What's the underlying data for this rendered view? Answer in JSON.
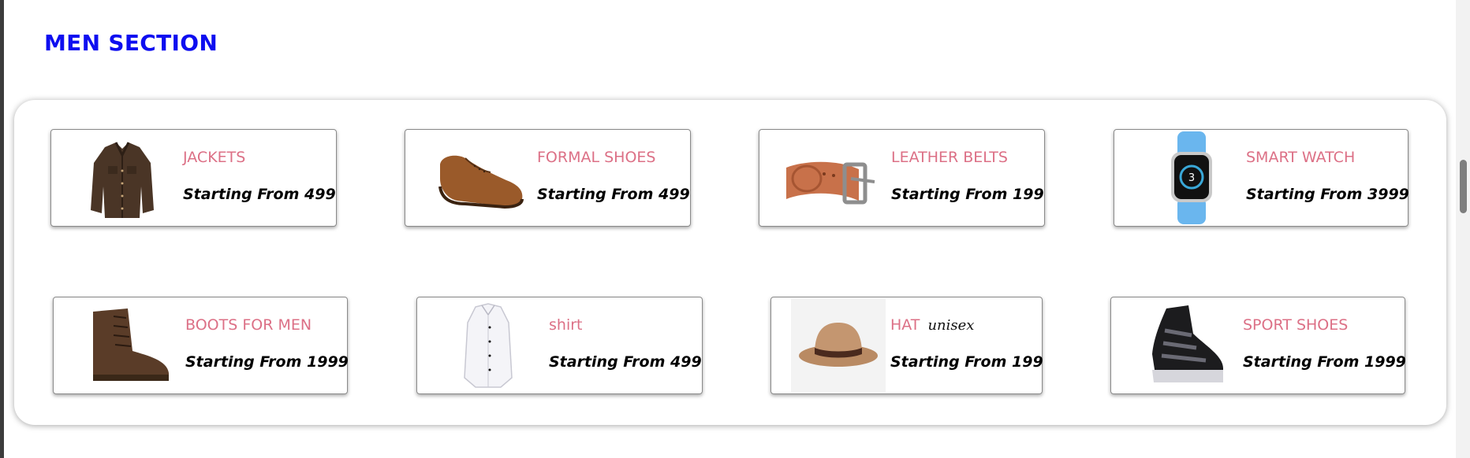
{
  "section": {
    "title": "MEN SECTION"
  },
  "products": [
    {
      "name": "JACKETS",
      "price": "Starting From 499",
      "icon": "jacket-image"
    },
    {
      "name": "FORMAL SHOES",
      "price": "Starting From 499",
      "icon": "formal-shoe-image"
    },
    {
      "name": "LEATHER BELTS",
      "price": "Starting From 199",
      "icon": "leather-belt-image"
    },
    {
      "name": "SMART WATCH",
      "price": "Starting From 3999",
      "icon": "smart-watch-image"
    },
    {
      "name": "BOOTS FOR MEN",
      "price": "Starting From 1999",
      "icon": "boot-image"
    },
    {
      "name": "shirt",
      "price": "Starting From 499",
      "icon": "shirt-image"
    },
    {
      "name": "HAT",
      "tag": "unisex",
      "price": "Starting From 199",
      "icon": "hat-image"
    },
    {
      "name": "SPORT SHOES",
      "price": "Starting From 1999",
      "icon": "sport-shoe-image"
    }
  ],
  "watch_screen": {
    "value": "3"
  },
  "colors": {
    "title": "#0e0ef0",
    "product_name": "#dc7086",
    "price": "#000000"
  }
}
